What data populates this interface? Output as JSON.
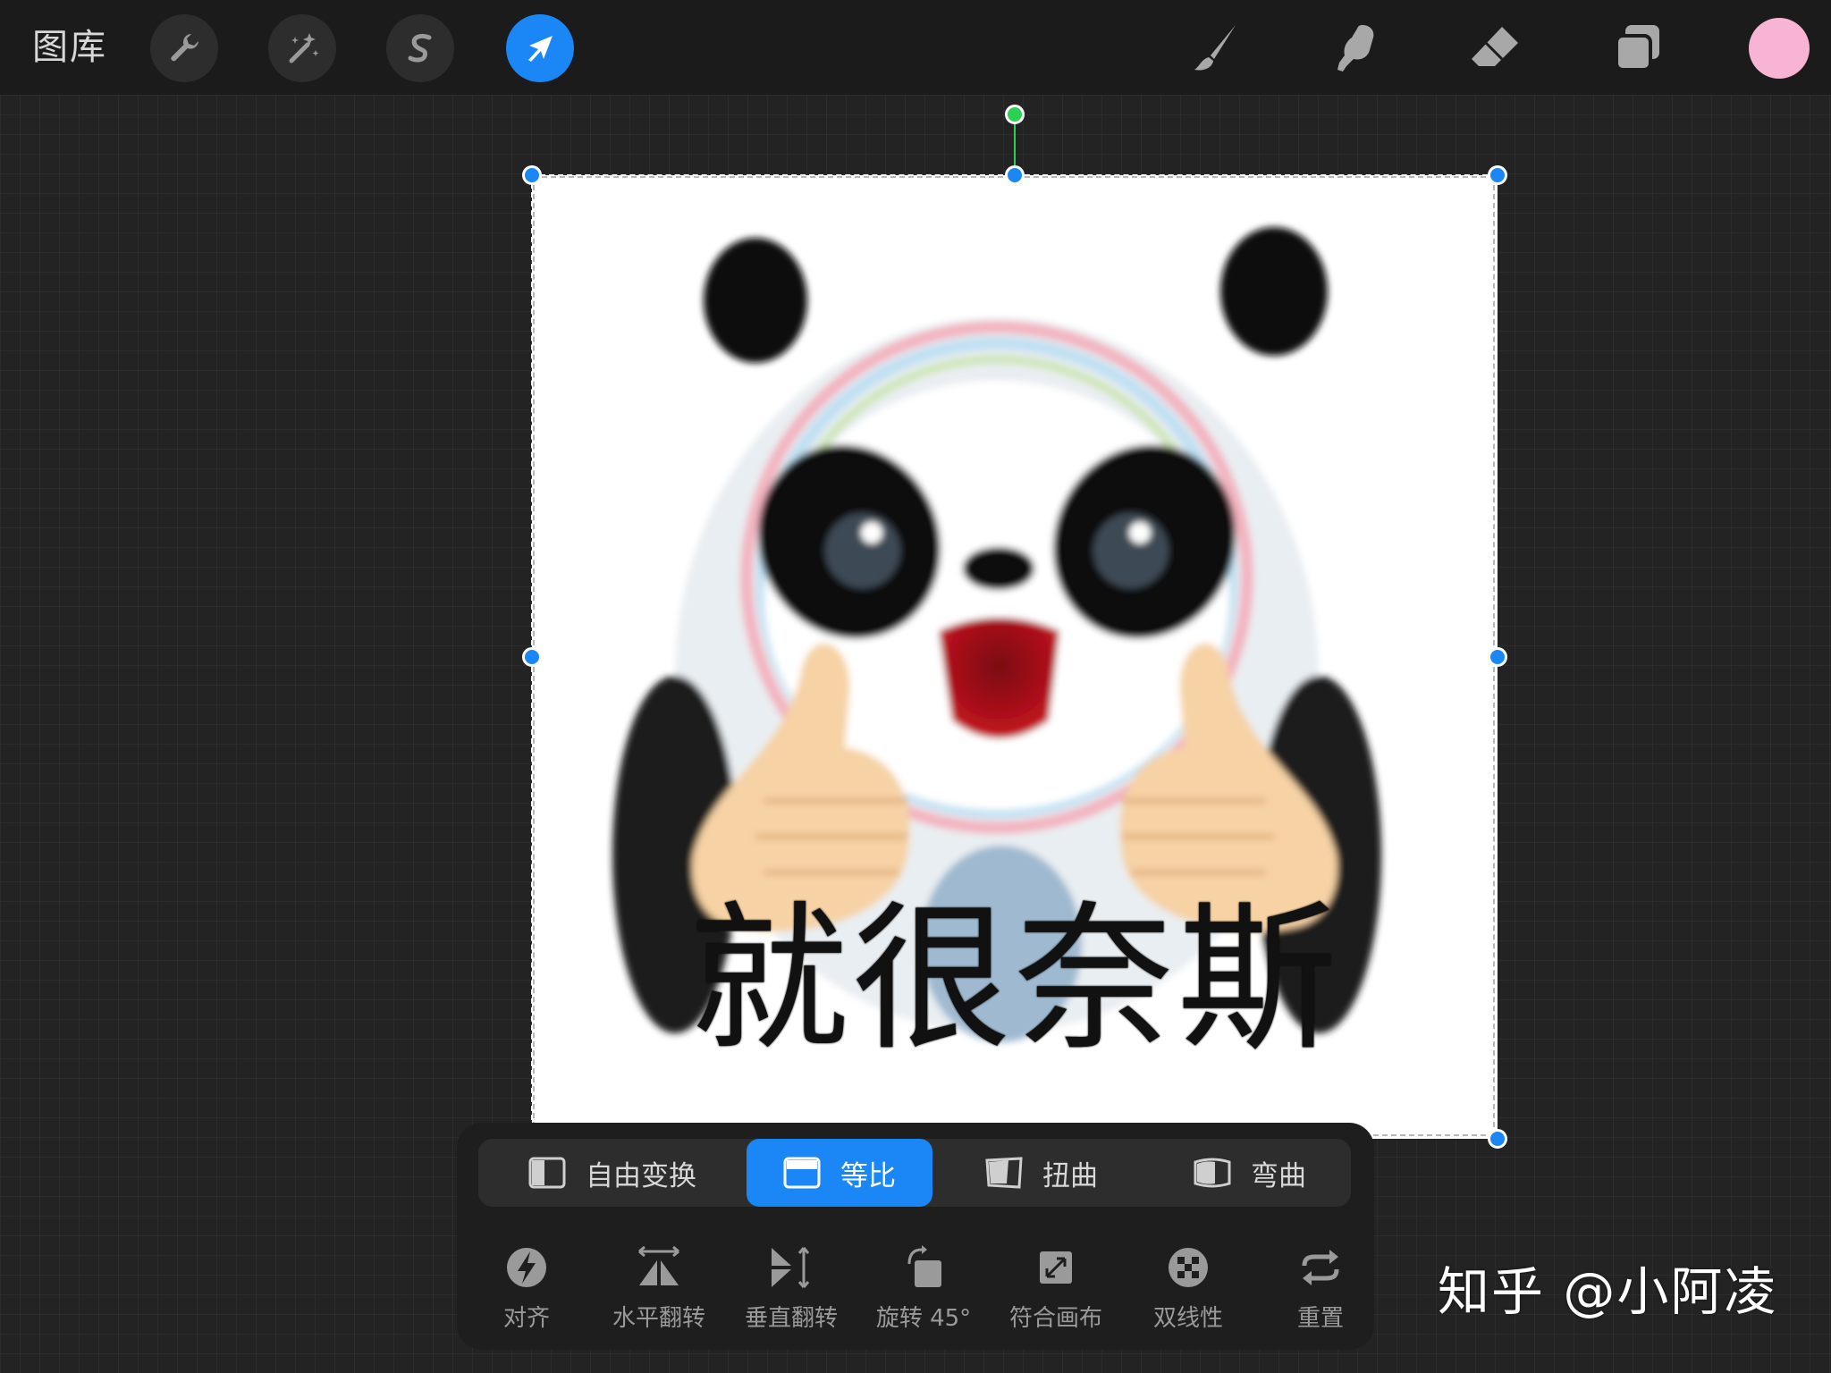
{
  "topbar": {
    "gallery_label": "图库",
    "left_tools": [
      {
        "name": "actions",
        "icon": "wrench-icon"
      },
      {
        "name": "adjustments",
        "icon": "magic-wand-icon"
      },
      {
        "name": "selection",
        "icon": "selection-s-icon"
      },
      {
        "name": "transform",
        "icon": "arrow-cursor-icon",
        "active": true
      }
    ],
    "right_tools": [
      {
        "name": "brush",
        "icon": "brush-icon"
      },
      {
        "name": "smudge",
        "icon": "smudge-finger-icon"
      },
      {
        "name": "eraser",
        "icon": "eraser-icon"
      },
      {
        "name": "layers",
        "icon": "layers-icon"
      }
    ],
    "current_color": "#f8b4d3"
  },
  "artwork": {
    "caption": "就很奈斯"
  },
  "transform_panel": {
    "modes": [
      {
        "label": "自由变换",
        "active": false
      },
      {
        "label": "等比",
        "active": true
      },
      {
        "label": "扭曲",
        "active": false
      },
      {
        "label": "弯曲",
        "active": false
      }
    ],
    "actions": [
      {
        "label": "对齐",
        "icon": "snapping-bolt-icon"
      },
      {
        "label": "水平翻转",
        "icon": "flip-horizontal-icon"
      },
      {
        "label": "垂直翻转",
        "icon": "flip-vertical-icon"
      },
      {
        "label": "旋转 45°",
        "icon": "rotate-45-icon"
      },
      {
        "label": "符合画布",
        "icon": "fit-canvas-icon"
      },
      {
        "label": "双线性",
        "icon": "bilinear-checker-icon"
      },
      {
        "label": "重置",
        "icon": "reset-arrows-icon"
      }
    ]
  },
  "watermark": "知乎 @小阿凌",
  "colors": {
    "accent": "#1b86f5",
    "rotate_handle": "#2bd154"
  }
}
